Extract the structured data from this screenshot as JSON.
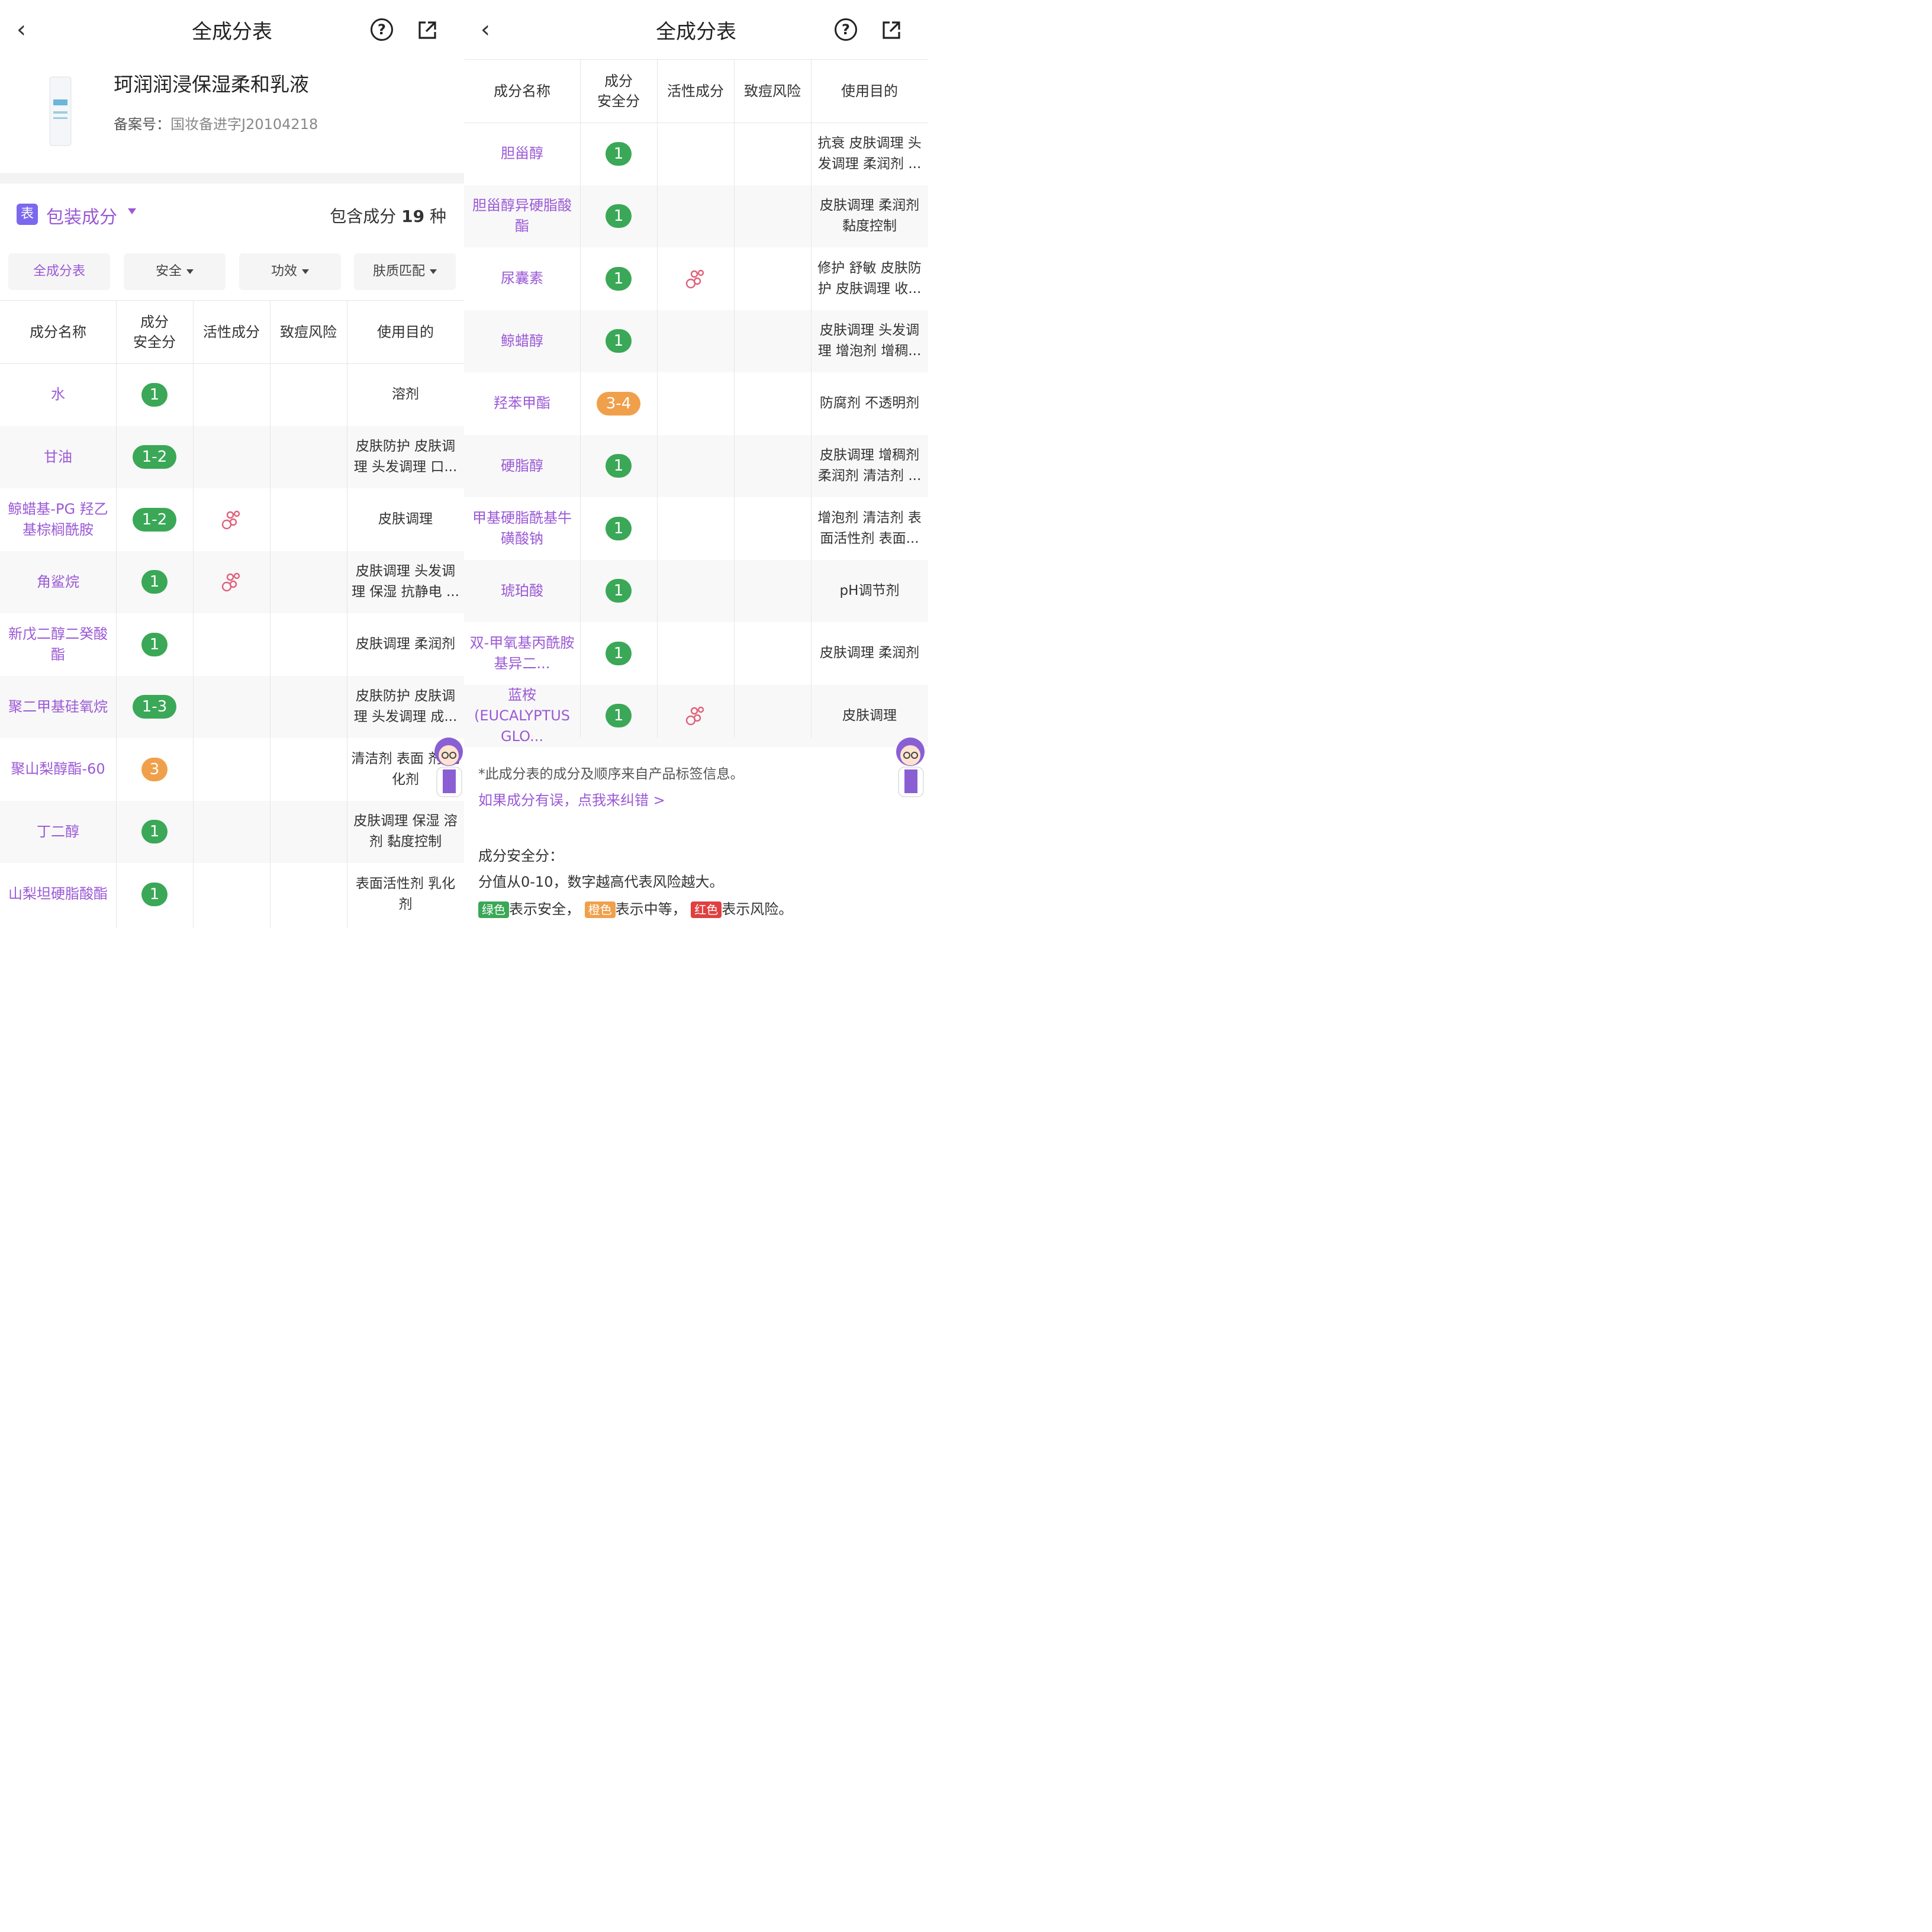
{
  "header": {
    "back_icon": "‹",
    "title": "全成分表",
    "help_icon": "?",
    "share_icon": "share-icon"
  },
  "product": {
    "name": "珂润润浸保湿柔和乳液",
    "reg_label": "备案号：",
    "reg_value": "国妆备进字J20104218"
  },
  "package": {
    "badge": "表",
    "label": "包装成分",
    "count_prefix": "包含成分",
    "count": "19",
    "count_suffix": "种"
  },
  "filters": [
    "全成分表",
    "安全",
    "功效",
    "肤质匹配"
  ],
  "columns": [
    "成分名称",
    "成分安全分",
    "活性成分",
    "致痘风险",
    "使用目的"
  ],
  "columns_split": {
    "safety_line1": "成分",
    "safety_line2": "安全分"
  },
  "left_rows": [
    {
      "name": "水",
      "score": "1",
      "color": "green",
      "active": false,
      "purpose": "溶剂"
    },
    {
      "name": "甘油",
      "score": "1-2",
      "color": "green",
      "active": false,
      "purpose": "皮肤防护 皮肤调理 头发调理 口..."
    },
    {
      "name": "鲸蜡基-PG 羟乙基棕榈酰胺",
      "score": "1-2",
      "color": "green",
      "active": true,
      "purpose": "皮肤调理"
    },
    {
      "name": "角鲨烷",
      "score": "1",
      "color": "green",
      "active": true,
      "purpose": "皮肤调理 头发调理 保湿 抗静电 ..."
    },
    {
      "name": "新戊二醇二癸酸酯",
      "score": "1",
      "color": "green",
      "active": false,
      "purpose": "皮肤调理 柔润剂"
    },
    {
      "name": "聚二甲基硅氧烷",
      "score": "1-3",
      "color": "green",
      "active": false,
      "purpose": "皮肤防护 皮肤调理 头发调理 成..."
    },
    {
      "name": "聚山梨醇酯-60",
      "score": "3",
      "color": "orange",
      "active": false,
      "purpose": "清洁剂 表面 剂 乳化剂"
    },
    {
      "name": "丁二醇",
      "score": "1",
      "color": "green",
      "active": false,
      "purpose": "皮肤调理 保湿 溶剂 黏度控制"
    },
    {
      "name": "山梨坦硬脂酸酯",
      "score": "1",
      "color": "green",
      "active": false,
      "purpose": "表面活性剂 乳化剂"
    }
  ],
  "right_rows": [
    {
      "name": "胆甾醇",
      "score": "1",
      "color": "green",
      "active": false,
      "purpose": "抗衰 皮肤调理 头发调理 柔润剂 ..."
    },
    {
      "name": "胆甾醇异硬脂酸酯",
      "score": "1",
      "color": "green",
      "active": false,
      "purpose": "皮肤调理 柔润剂 黏度控制"
    },
    {
      "name": "尿囊素",
      "score": "1",
      "color": "green",
      "active": true,
      "purpose": "修护 舒敏 皮肤防护 皮肤调理 收..."
    },
    {
      "name": "鲸蜡醇",
      "score": "1",
      "color": "green",
      "active": false,
      "purpose": "皮肤调理 头发调理 增泡剂 增稠..."
    },
    {
      "name": "羟苯甲酯",
      "score": "3-4",
      "color": "orange",
      "active": false,
      "purpose": "防腐剂 不透明剂"
    },
    {
      "name": "硬脂醇",
      "score": "1",
      "color": "green",
      "active": false,
      "purpose": "皮肤调理 增稠剂 柔润剂 清洁剂 ..."
    },
    {
      "name": "甲基硬脂酰基牛磺酸钠",
      "score": "1",
      "color": "green",
      "active": false,
      "purpose": "增泡剂 清洁剂 表面活性剂 表面..."
    },
    {
      "name": "琥珀酸",
      "score": "1",
      "color": "green",
      "active": false,
      "purpose": "pH调节剂"
    },
    {
      "name": "双-甲氧基丙酰胺基异二...",
      "score": "1",
      "color": "green",
      "active": false,
      "purpose": "皮肤调理 柔润剂"
    },
    {
      "name": "蓝桉(EUCALYPTUS GLO...",
      "score": "1",
      "color": "green",
      "active": true,
      "purpose": "皮肤调理"
    }
  ],
  "footer": {
    "note1": "*此成分表的成分及顺序来自产品标签信息。",
    "note2": "如果成分有误，点我来纠错 >",
    "note3": "成分安全分：",
    "note4": "分值从0-10，数字越高代表风险越大。",
    "legend_green_tag": "绿色",
    "legend_green_text": "表示安全，",
    "legend_orange_tag": "橙色",
    "legend_orange_text": "表示中等，",
    "legend_red_tag": "红色",
    "legend_red_text": "表示风险。"
  },
  "colors": {
    "accent": "#9b59d6",
    "safe": "#3aa857",
    "medium": "#f0a04b",
    "risk": "#e04040",
    "active_icon": "#e0607a"
  }
}
